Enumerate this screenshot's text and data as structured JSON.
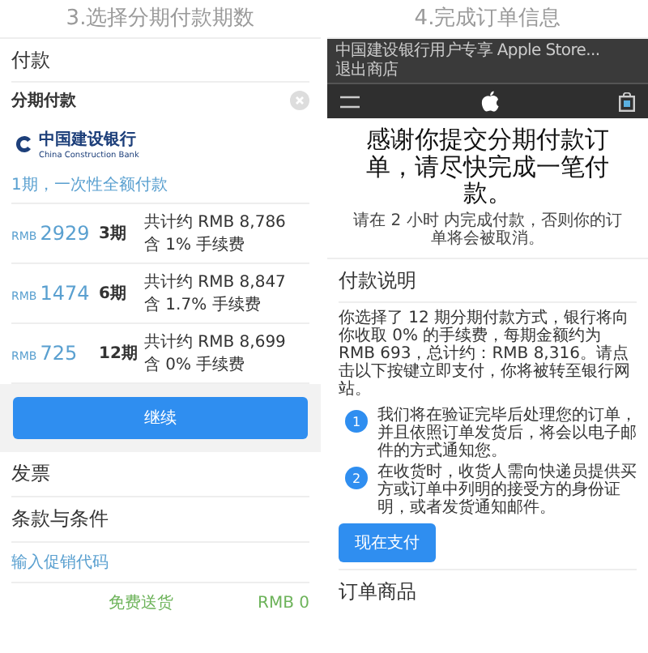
{
  "left": {
    "caption": "3.选择分期付款期数",
    "heading": "付款",
    "method": {
      "label": "分期付款"
    },
    "bank": {
      "name": "中国建设银行",
      "name_en": "China Construction Bank"
    },
    "full_payment_link": "1期，一次性全额付款",
    "plans": [
      {
        "amount": "2929",
        "currency": "RMB",
        "term": "3期",
        "total": "共计约 RMB 8,786",
        "fee": "含 1% 手续费"
      },
      {
        "amount": "1474",
        "currency": "RMB",
        "term": "6期",
        "total": "共计约 RMB 8,847",
        "fee": "含 1.7% 手续费"
      },
      {
        "amount": "725",
        "currency": "RMB",
        "term": "12期",
        "total": "共计约 RMB 8,699",
        "fee": "含 0% 手续费"
      }
    ],
    "continue_button": "继续",
    "sections": [
      "发票",
      "条款与条件"
    ],
    "promo_link": "输入促销代码",
    "shipping": {
      "label": "免费送货",
      "price": "RMB 0"
    }
  },
  "right": {
    "caption": "4.完成订单信息",
    "top_bar": {
      "text": "中国建设银行用户专享 Apple Store...",
      "exit": "退出商店"
    },
    "heading": "感谢你提交分期付款订单，请尽快完成一笔付款。",
    "notice": "请在 2 小时 内完成付款，否则你的订单将会被取消。",
    "section_title": "付款说明",
    "description": "你选择了 12 期分期付款方式，银行将向你收取 0% 的手续费，每期金额约为 RMB 693，总计约：RMB 8,316。请点击以下按键立即支付，你将被转至银行网站。",
    "steps": [
      {
        "number": "1",
        "text": "我们将在验证完毕后处理您的订单，并且依照订单发货后，将会以电子邮件的方式通知您。"
      },
      {
        "number": "2",
        "text": "在收货时，收货人需向快递员提供买方或订单中列明的接受方的身份证明，或者发货通知邮件。"
      }
    ],
    "pay_button": "现在支付",
    "order_title": "订单商品"
  }
}
